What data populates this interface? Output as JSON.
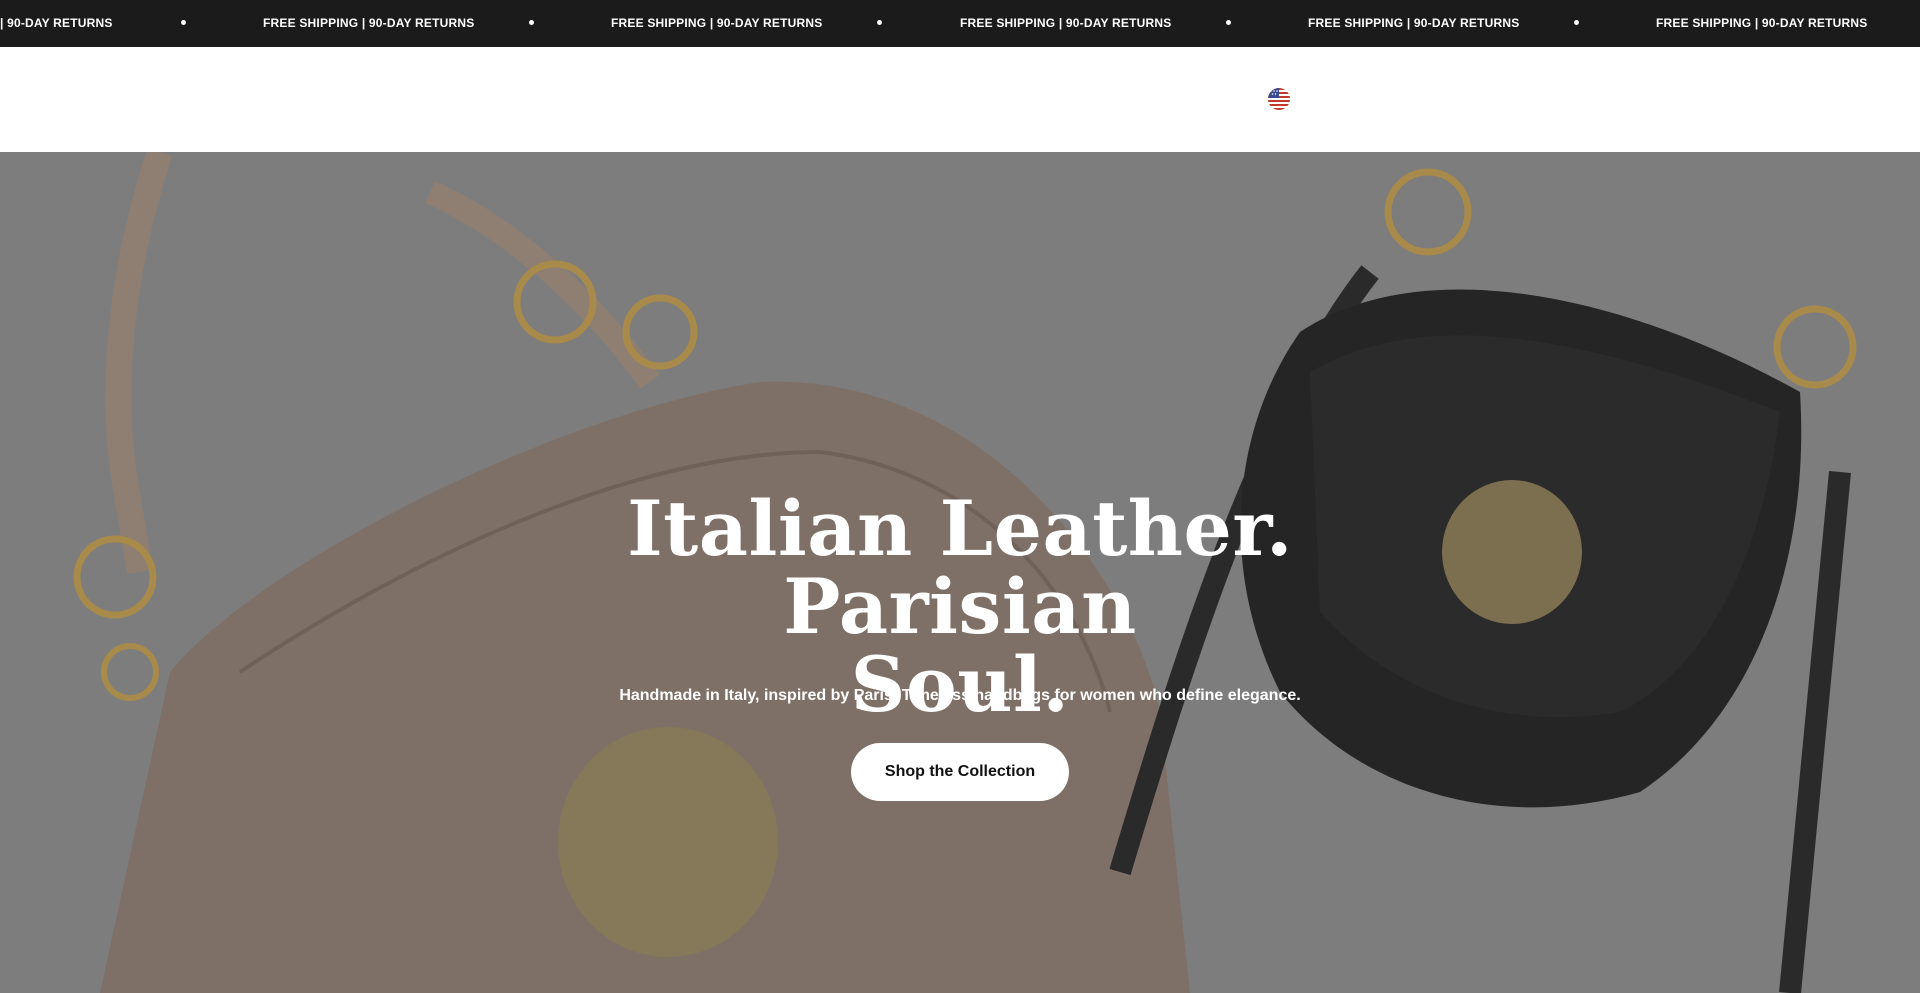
{
  "announcement": {
    "items": [
      "FREE SHIPPING | 90-DAY RETURNS",
      "FREE SHIPPING | 90-DAY RETURNS",
      "FREE SHIPPING | 90-DAY RETURNS",
      "FREE SHIPPING | 90-DAY RETURNS",
      "FREE SHIPPING | 90-DAY RETURNS",
      "FREE SHIPPING | 90-DAY RETURNS"
    ],
    "first_partial": "| 90-DAY RETURNS"
  },
  "header": {
    "country_icon": "us-flag-icon"
  },
  "hero": {
    "title_line1": "Italian Leather. Parisian",
    "title_line2": "Soul.",
    "subtitle": "Handmade in Italy, inspired by Paris. Timeless handbags for women who define elegance.",
    "cta_label": "Shop the Collection"
  },
  "colors": {
    "announcement_bg": "#1b1b1b",
    "hero_overlay": "#808080",
    "cta_bg": "#ffffff"
  }
}
